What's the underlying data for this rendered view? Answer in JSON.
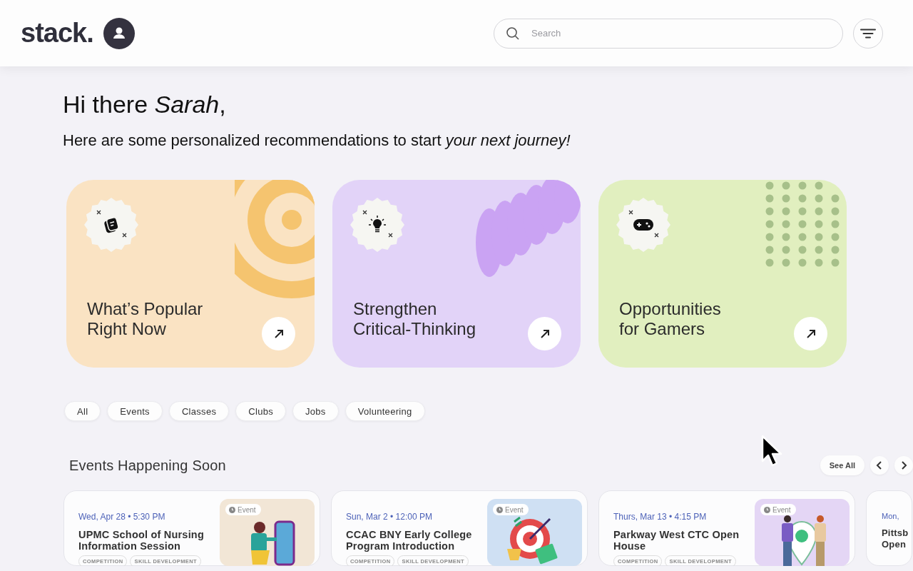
{
  "header": {
    "logo": "stack.",
    "search": {
      "placeholder": "Search"
    }
  },
  "greeting": {
    "title": "Hi there *Sarah*,",
    "subtitle": "Here are some personalized recommendations to start *your next journey!*"
  },
  "recommendations": [
    {
      "kind": "rings",
      "lines": [
        "What’s Popular",
        "Right Now"
      ],
      "color": "#fae3c3"
    },
    {
      "kind": "waves",
      "lines": [
        "Strengthen",
        "Critical-Thinking"
      ],
      "color": "#e2d3f8"
    },
    {
      "kind": "dots",
      "lines": [
        "Opportunities",
        "for Gamers"
      ],
      "color": "#e1efbf"
    }
  ],
  "filters": [
    "All",
    "Events",
    "Classes",
    "Clubs",
    "Jobs",
    "Volunteering"
  ],
  "section": {
    "title": "Events Happening Soon",
    "see_all": "See All"
  },
  "events": [
    {
      "date": "Wed, Apr 28 • 5:30 PM",
      "title": "UPMC School of Nursing Information Session",
      "badge": "Event",
      "tags": [
        "COMPETITION",
        "SKILL DEVELOPMENT"
      ]
    },
    {
      "date": "Sun, Mar 2 • 12:00 PM",
      "title": "CCAC BNY Early College Program Introduction",
      "badge": "Event",
      "tags": [
        "COMPETITION",
        "SKILL DEVELOPMENT"
      ]
    },
    {
      "date": "Thurs, Mar 13 • 4:15 PM",
      "title": "Parkway West CTC Open House",
      "badge": "Event",
      "tags": [
        "COMPETITION",
        "SKILL DEVELOPMENT"
      ]
    },
    {
      "date": "Mon,",
      "title": "Pittsb Open"
    }
  ]
}
